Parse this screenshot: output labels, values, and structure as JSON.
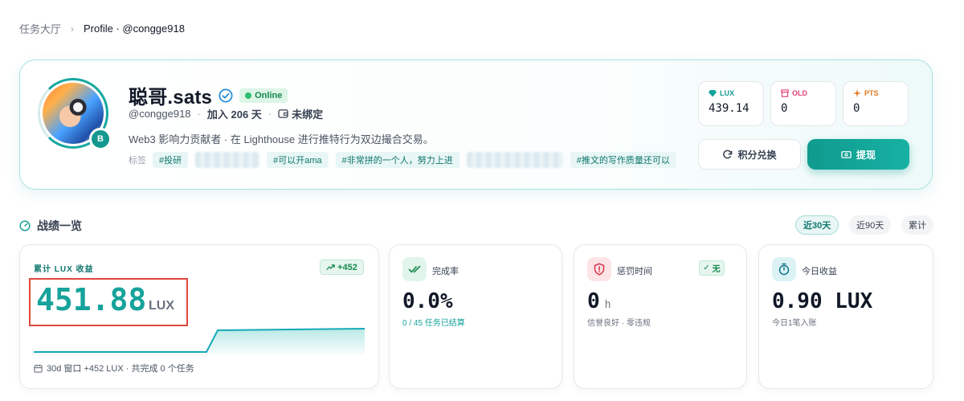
{
  "breadcrumb": {
    "home": "任务大厅",
    "current": "Profile · @congge918"
  },
  "profile": {
    "name": "聪哥.sats",
    "status": "Online",
    "badge_letter": "B",
    "handle": "@congge918",
    "joined": "加入 206 天",
    "wallet": "未绑定",
    "bio": "Web3 影响力贡献者 · 在 Lighthouse 进行推特行为双边撮合交易。",
    "tags_label": "标签",
    "tags": [
      "#投研",
      "#可以开ama",
      "#非常拼的一个人，努力上进",
      "#推文的写作质量还可以"
    ]
  },
  "points": [
    {
      "label": "LUX",
      "value": "439.14",
      "color": "#0f9b8e",
      "icon": "gem-icon"
    },
    {
      "label": "OLD",
      "value": "0",
      "color": "#e0457b",
      "icon": "archive-icon"
    },
    {
      "label": "PTS",
      "value": "0",
      "color": "#e07a1f",
      "icon": "sparkle-icon"
    }
  ],
  "actions": {
    "redeem": "积分兑换",
    "withdraw": "提现"
  },
  "overview": {
    "title": "战绩一览",
    "ranges": [
      "近30天",
      "近90天",
      "累计"
    ],
    "active_range": "近30天"
  },
  "stats": {
    "lux": {
      "label": "累计 LUX 收益",
      "trend": "+452",
      "value": "451.88",
      "unit": "LUX",
      "footer": "30d 窗口 +452 LUX · 共完成 0 个任务"
    },
    "completion": {
      "label": "完成率",
      "value": "0.0%",
      "sub": "0 / 45 任务已结算"
    },
    "penalty": {
      "label": "惩罚时间",
      "badge": "无",
      "value": "0",
      "unit": "h",
      "sub": "信誉良好 · 零违规"
    },
    "today": {
      "label": "今日收益",
      "value": "0.90 LUX",
      "sub": "今日1笔入账"
    }
  },
  "colors": {
    "accent": "#0f9b8e",
    "highlight_border": "#e0473d"
  }
}
